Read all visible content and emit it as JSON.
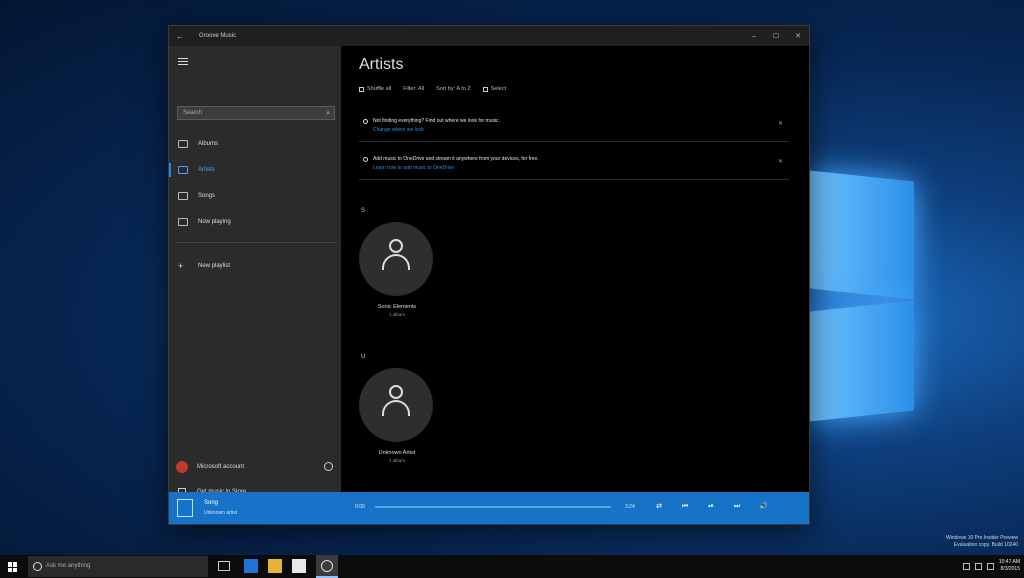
{
  "window": {
    "title": "Groove Music",
    "back_glyph": "←",
    "minimize": "–",
    "maximize": "☐",
    "close": "✕"
  },
  "sidebar": {
    "search_placeholder": "Search",
    "items": [
      {
        "label": "Albums",
        "active": false
      },
      {
        "label": "Artists",
        "active": true
      },
      {
        "label": "Songs",
        "active": false
      },
      {
        "label": "Now playing",
        "active": false
      }
    ],
    "new_playlist": "New playlist",
    "user_name": "Microsoft account",
    "store_link": "Get music in Store"
  },
  "main": {
    "title": "Artists",
    "filters": [
      {
        "label": "Shuffle all"
      },
      {
        "label": "Filter: All"
      },
      {
        "label": "Sort by: A to Z"
      },
      {
        "label": "Select"
      }
    ],
    "notices": [
      {
        "text": "Not finding everything? Find out where we look for music.",
        "link": "Change where we look"
      },
      {
        "text": "Add music to OneDrive and stream it anywhere from your devices, for free.",
        "link": "Learn how to add music to OneDrive"
      }
    ],
    "groups": [
      {
        "letter": "S",
        "artist": "Sonic Elements",
        "sub": "1 album"
      },
      {
        "letter": "U",
        "artist": "Unknown Artist",
        "sub": "1 album"
      }
    ]
  },
  "player": {
    "title": "Song",
    "artist": "Unknown artist",
    "time_start": "0:00",
    "time_end": "3:24",
    "controls": [
      "⇄",
      "⏮",
      "⏯",
      "⏭",
      "🔊"
    ]
  },
  "taskbar": {
    "cortana_placeholder": "Ask me anything",
    "time": "10:47 AM",
    "date": "8/3/2015"
  },
  "watermark": {
    "line1": "Windows 10 Pro Insider Preview",
    "line2": "Evaluation copy. Build 10240"
  },
  "colors": {
    "accent": "#1673c8",
    "sidebar": "#2b2b2b",
    "active": "#4aa3f0"
  }
}
